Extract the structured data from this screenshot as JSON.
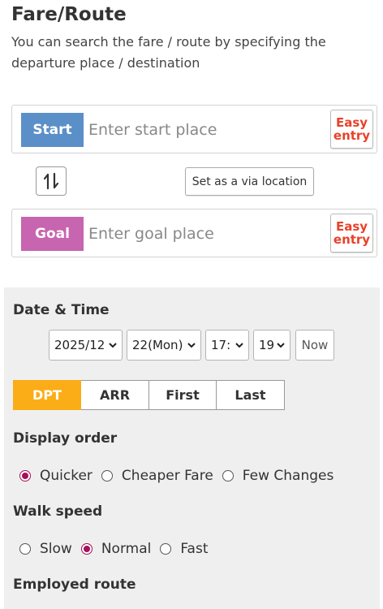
{
  "header": {
    "title": "Fare/Route",
    "description": "You can search the fare / route by specifying the departure place / destination"
  },
  "start": {
    "tag": "Start",
    "placeholder": "Enter start place",
    "easy_entry": [
      "Easy",
      "entry"
    ],
    "tag_color": "#5b8fc7"
  },
  "swap": {
    "icon": "swap-vertical-icon"
  },
  "via": {
    "label": "Set as a via location"
  },
  "goal": {
    "tag": "Goal",
    "placeholder": "Enter goal place",
    "easy_entry": [
      "Easy",
      "entry"
    ],
    "tag_color": "#c765b0"
  },
  "datetime": {
    "label": "Date & Time",
    "month": "2025/12",
    "day": "22(Mon)",
    "hour": "17:",
    "minute": "19",
    "now_label": "Now"
  },
  "mode": {
    "tabs": [
      "DPT",
      "ARR",
      "First",
      "Last"
    ],
    "active": "DPT",
    "active_color": "#fbad18"
  },
  "display_order": {
    "label": "Display order",
    "options": [
      "Quicker",
      "Cheaper Fare",
      "Few Changes"
    ],
    "selected": "Quicker"
  },
  "walk_speed": {
    "label": "Walk speed",
    "options": [
      "Slow",
      "Normal",
      "Fast"
    ],
    "selected": "Normal"
  },
  "employed_route": {
    "label": "Employed route"
  },
  "colors": {
    "easy_entry_text": "#e8422a",
    "radio_checked": "#a60f5a",
    "panel_bg": "#efefef"
  }
}
